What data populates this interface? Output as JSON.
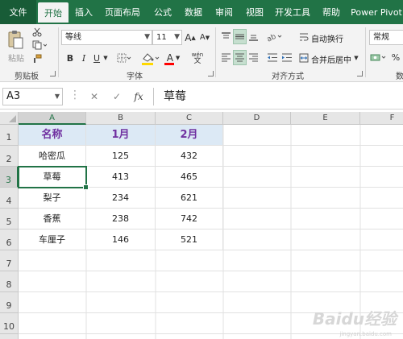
{
  "tabs": [
    "文件",
    "开始",
    "插入",
    "页面布局",
    "公式",
    "数据",
    "审阅",
    "视图",
    "开发工具",
    "帮助",
    "Power Pivot"
  ],
  "ribbon": {
    "paste_label": "粘贴",
    "clipboard_label": "剪贴板",
    "font_name": "等线",
    "font_size": "11",
    "grow_font": "A",
    "shrink_font": "A",
    "bold": "B",
    "italic": "I",
    "underline": "U",
    "font_color_letter": "A",
    "phonetic": "wén",
    "font_group_label": "字体",
    "wrap_text": "自动换行",
    "merge_center": "合并后居中",
    "alignment_group_label": "对齐方式",
    "number_format": "常规",
    "percent": "%",
    "number_group_label_partial": "数",
    "highlight_color": "#ffd800",
    "font_color": "#ff0000"
  },
  "formula_bar": {
    "name_box": "A3",
    "cancel": "✕",
    "enter": "✓",
    "fx": "fx",
    "content": "草莓"
  },
  "sheet": {
    "columns": [
      "A",
      "B",
      "C",
      "D",
      "E",
      "F"
    ],
    "rows": [
      "1",
      "2",
      "3",
      "4",
      "5",
      "6",
      "7",
      "8",
      "9",
      "10"
    ],
    "header": [
      "名称",
      "1月",
      "2月"
    ],
    "data": [
      [
        "哈密瓜",
        "125",
        "432"
      ],
      [
        "草莓",
        "413",
        "465"
      ],
      [
        "梨子",
        "234",
        "621"
      ],
      [
        "香蕉",
        "238",
        "742"
      ],
      [
        "车厘子",
        "146",
        "521"
      ]
    ],
    "active_cell": "A3",
    "header_fill": "#dce9f5",
    "header_text_color": "#7030a0"
  },
  "watermark": {
    "main": "Baidu经验",
    "sub": "jingyan.baidu.com"
  }
}
